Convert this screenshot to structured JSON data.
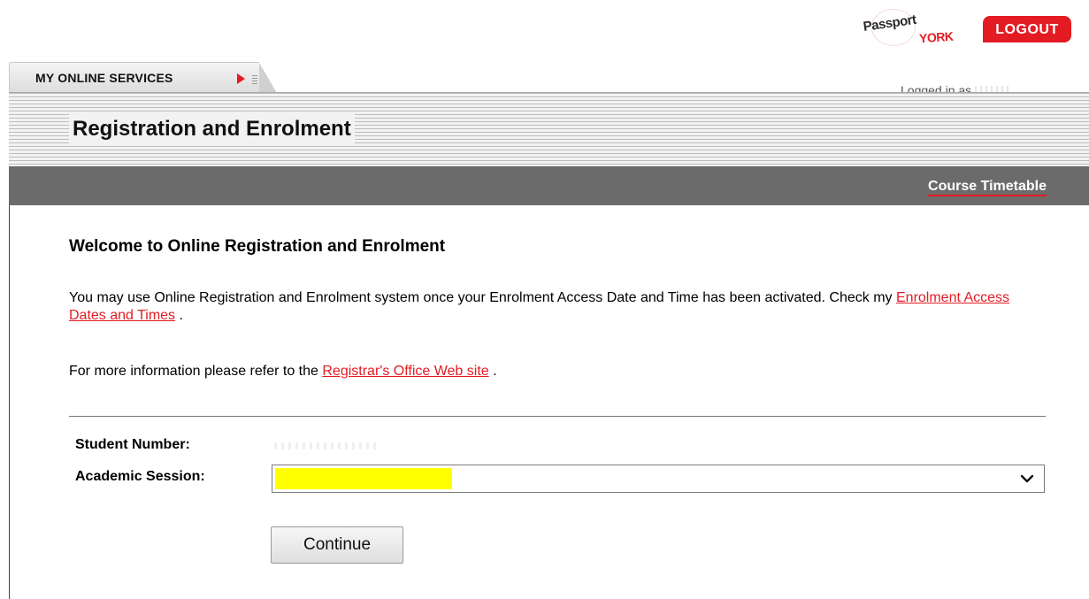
{
  "header": {
    "logo_text_1": "Passport",
    "logo_text_2": "YORK",
    "logout_label": "LOGOUT",
    "logged_in_label": "Logged in as"
  },
  "tab": {
    "label": "MY ONLINE SERVICES"
  },
  "page": {
    "title": "Registration and Enrolment"
  },
  "nav": {
    "course_timetable": "Course Timetable"
  },
  "content": {
    "heading": "Welcome to Online Registration and Enrolment",
    "intro_text": "You may use Online Registration and Enrolment system once your Enrolment Access Date and Time has been activated. Check my",
    "intro_link": "Enrolment Access Dates and Times",
    "intro_end": ".",
    "info_text": "For more information please refer to the",
    "info_link": "Registrar's Office Web site",
    "info_end": "."
  },
  "form": {
    "student_number_label": "Student Number:",
    "academic_session_label": "Academic Session:",
    "continue_label": "Continue"
  },
  "colors": {
    "brand_red": "#e31b23",
    "nav_bar": "#6b6b6b",
    "highlight": "#ffff00"
  },
  "icons": {
    "tab_arrow": "triangle-right-icon",
    "select_chevron": "chevron-down-icon"
  }
}
